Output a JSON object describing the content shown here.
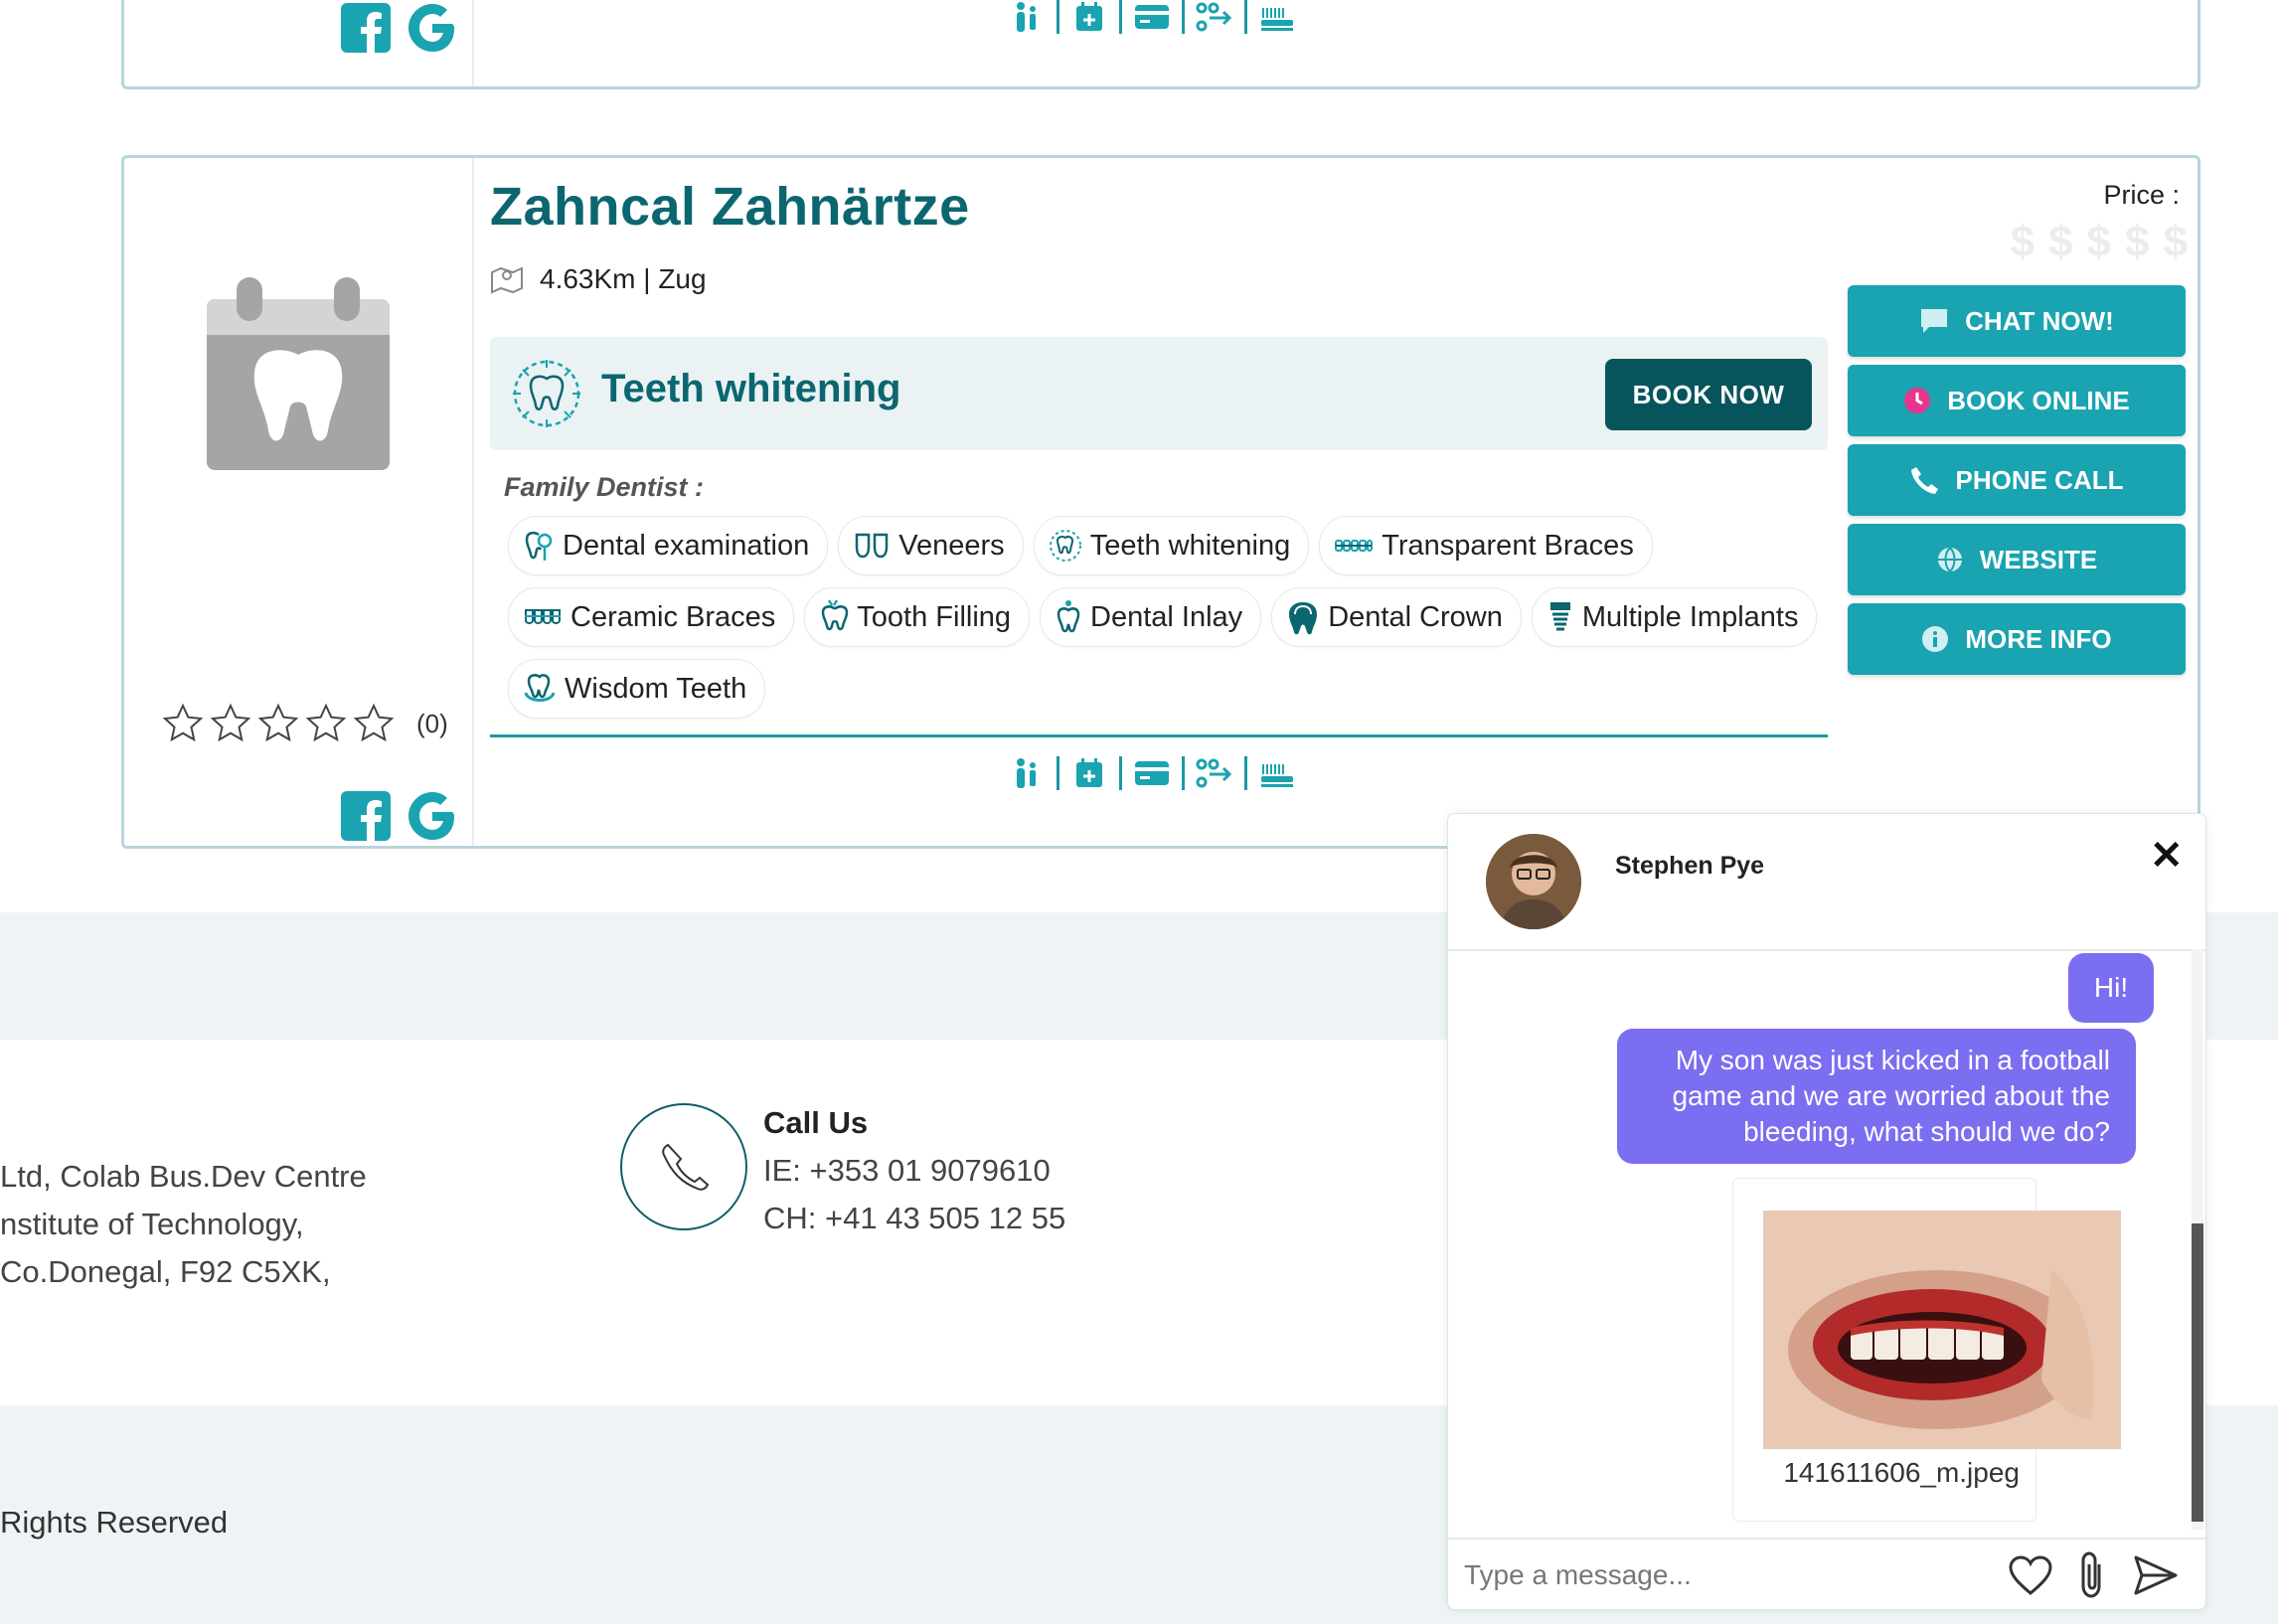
{
  "listing": {
    "name": "Zahncal Zahnärtze",
    "distance": "4.63Km | Zug",
    "price_label": "Price :",
    "price_symbols": [
      "$",
      "$",
      "$",
      "$",
      "$"
    ],
    "price_level": 0,
    "featured_service": "Teeth whitening",
    "book_now": "BOOK NOW",
    "category": "Family Dentist :",
    "services": [
      "Dental examination",
      "Veneers",
      "Teeth whitening",
      "Transparent Braces",
      "Ceramic Braces",
      "Tooth Filling",
      "Dental Inlay",
      "Dental Crown",
      "Multiple Implants",
      "Wisdom Teeth"
    ],
    "rating": {
      "stars": 0,
      "max": 5,
      "count": "(0)"
    },
    "actions": [
      "CHAT NOW!",
      "BOOK ONLINE",
      "PHONE CALL",
      "WEBSITE",
      "MORE INFO"
    ],
    "accent": "#1aa3b0",
    "dark_accent": "#06555c"
  },
  "footer": {
    "address_lines": [
      "Ltd, Colab Bus.Dev Centre",
      "nstitute of Technology,",
      "Co.Donegal, F92 C5XK,"
    ],
    "call_title": "Call Us",
    "phone_ie": "IE:  +353 01 9079610",
    "phone_ch": "CH:  +41 43 505 12 55",
    "rights": "Rights Reserved"
  },
  "chat": {
    "contact_name": "Stephen Pye",
    "close_label": "✕",
    "messages": [
      {
        "from": "user",
        "text": "Hi!"
      },
      {
        "from": "user",
        "text": "My son was just kicked in a football game and we are worried about the bleeding, what should we do?"
      }
    ],
    "attachment_name": "141611606_m.jpeg",
    "input_placeholder": "Type a message...",
    "bubble_color": "#7b6ef0"
  }
}
